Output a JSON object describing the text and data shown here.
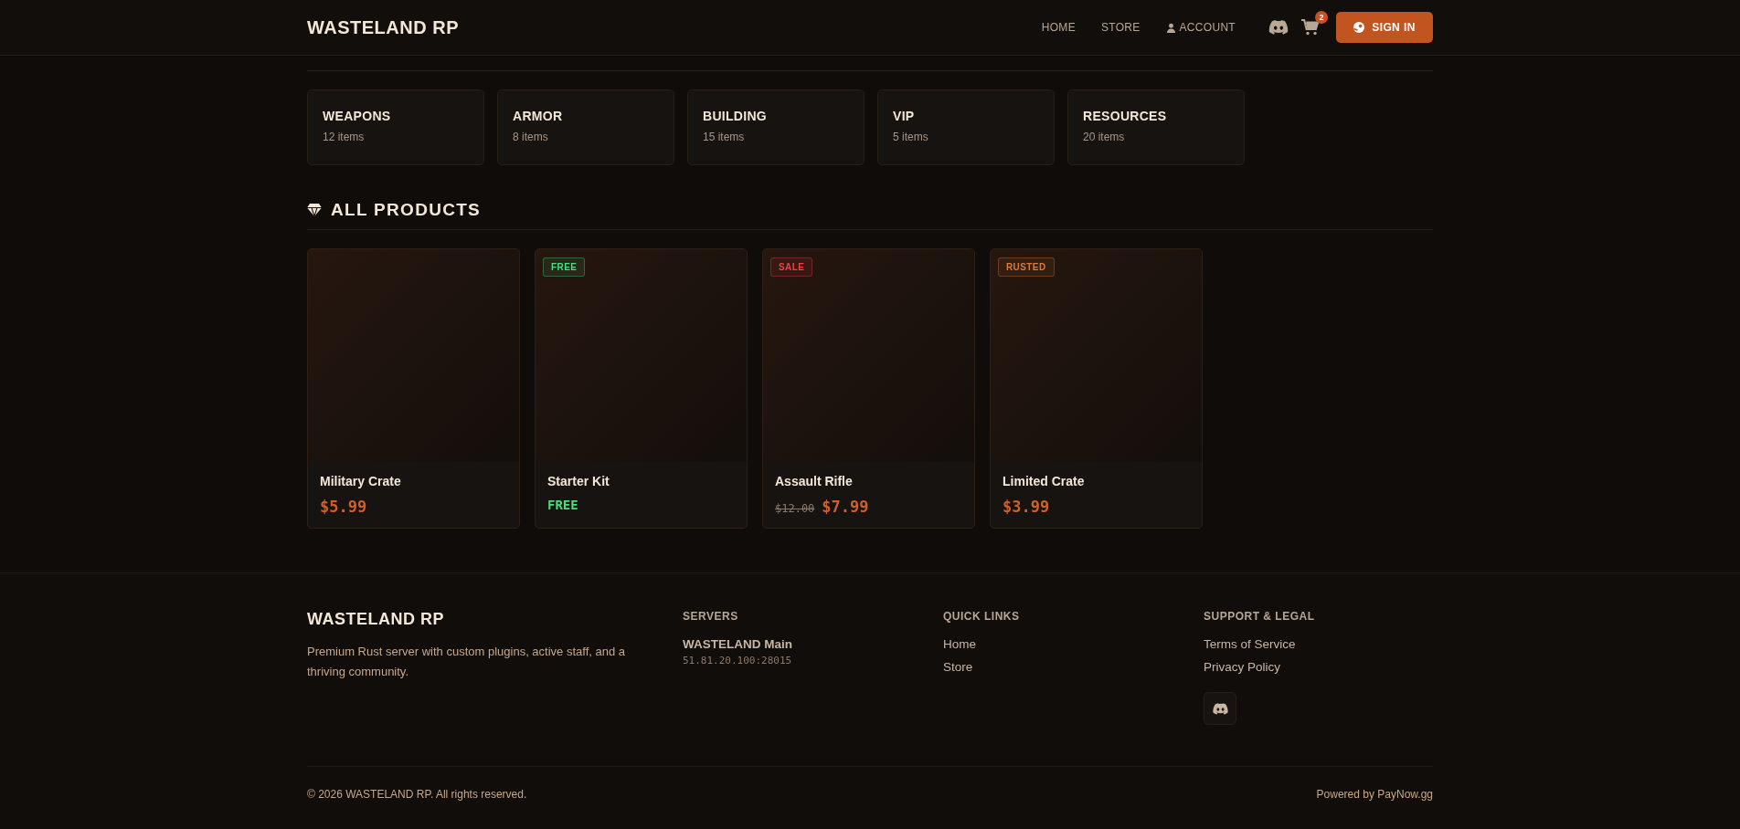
{
  "header": {
    "logo": "WASTELAND RP",
    "nav": [
      {
        "label": "HOME",
        "kind": "link"
      },
      {
        "label": "STORE",
        "kind": "link"
      },
      {
        "label": "ACCOUNT",
        "kind": "account"
      }
    ],
    "cart_count": "2",
    "sign_in": "SIGN IN"
  },
  "categories": {
    "items": [
      {
        "name": "WEAPONS",
        "count": "12 items"
      },
      {
        "name": "ARMOR",
        "count": "8 items"
      },
      {
        "name": "BUILDING",
        "count": "15 items"
      },
      {
        "name": "VIP",
        "count": "5 items"
      },
      {
        "name": "RESOURCES",
        "count": "20 items"
      }
    ]
  },
  "products": {
    "title": "ALL PRODUCTS",
    "items": [
      {
        "name": "Military Crate",
        "price": "$5.99",
        "kind": "normal"
      },
      {
        "name": "Starter Kit",
        "price": "FREE",
        "kind": "free",
        "badge": "FREE",
        "color": "#4ade80"
      },
      {
        "name": "Assault Rifle",
        "old_price": "$12.00",
        "price": "$7.99",
        "kind": "sale",
        "badge": "SALE",
        "color": "#ef4444"
      },
      {
        "name": "Limited Crate",
        "price": "$3.99",
        "kind": "normal",
        "badge": "RUSTED",
        "color": "#d97a3a"
      }
    ]
  },
  "footer": {
    "brand": "WASTELAND RP",
    "description": "Premium Rust server with custom plugins, active staff, and a thriving community.",
    "servers": {
      "title": "SERVERS",
      "name": "WASTELAND Main",
      "address": "51.81.20.100:28015"
    },
    "quick_links": {
      "title": "QUICK LINKS",
      "links": [
        "Home",
        "Store"
      ]
    },
    "support": {
      "title": "SUPPORT & LEGAL",
      "links": [
        "Terms of Service",
        "Privacy Policy"
      ]
    },
    "copyright": "© 2026 WASTELAND RP. All rights reserved.",
    "powered": "Powered by PayNow.gg"
  }
}
